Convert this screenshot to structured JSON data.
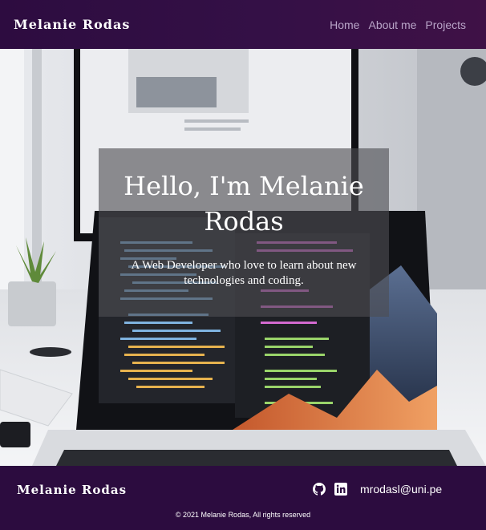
{
  "navbar": {
    "brand": "Melanie Rodas",
    "links": [
      "Home",
      "About me",
      "Projects"
    ]
  },
  "hero": {
    "title": "Hello, I'm Melanie Rodas",
    "subtitle": "A Web Developer who love to learn about new technologies and coding.",
    "image": "laptop-with-code-editor-photo"
  },
  "footer": {
    "brand": "Melanie Rodas",
    "social_icons": [
      "github-icon",
      "linkedin-icon"
    ],
    "email": "mrodasl@uni.pe",
    "copyright": "© 2021 Melanie Rodas, All rights reserved"
  },
  "colors": {
    "nav_bg": "#2d0c40",
    "footer_bg": "#2c0c3f",
    "nav_link": "#b9a5c8",
    "card_overlay": "#4e4e52"
  }
}
